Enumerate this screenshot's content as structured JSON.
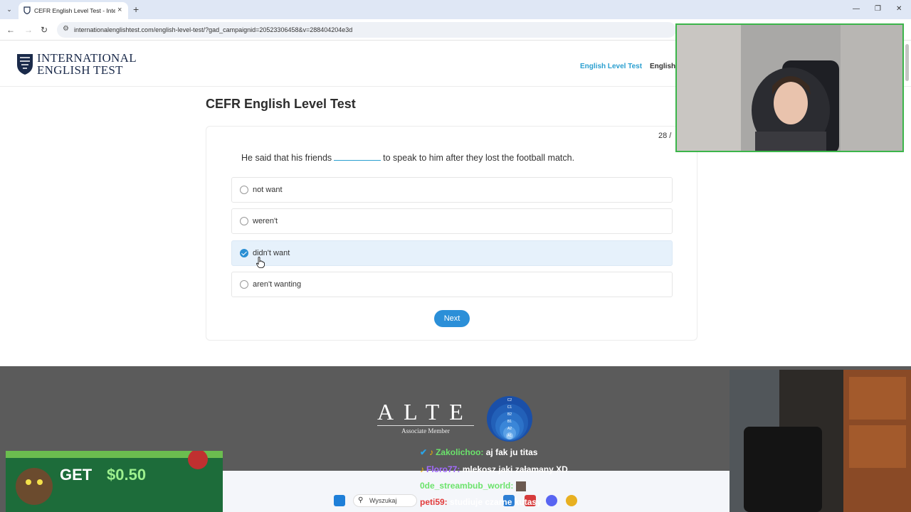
{
  "browser": {
    "tab_title": "CEFR English Level Test - Intern",
    "url": "internationalenglishtest.com/english-level-test/?gad_campaignid=20523306458&v=288404204e3d"
  },
  "site": {
    "logo_line1": "INTERNATIONAL",
    "logo_line2": "ENGLISH TEST",
    "nav_active": "English Level Test",
    "nav_second": "English"
  },
  "test": {
    "title": "CEFR English Level Test",
    "counter": "28 /",
    "question_before": "He said that his friends",
    "question_after": "to speak to him after they lost the football match.",
    "options": [
      {
        "label": "not want",
        "selected": false
      },
      {
        "label": "weren't",
        "selected": false
      },
      {
        "label": "didn't want",
        "selected": true
      },
      {
        "label": "aren't wanting",
        "selected": false
      }
    ],
    "next_label": "Next"
  },
  "footer": {
    "alte_title": "ALTE",
    "alte_subtitle": "Associate Member",
    "cefr_levels": [
      "C2",
      "C1",
      "B2",
      "B1",
      "A2",
      "A1"
    ]
  },
  "overlay": {
    "ad_get": "GET",
    "ad_amount": "$0.50",
    "chat": [
      {
        "user": "Zakolichoo:",
        "message": "aj fak ju titas",
        "user_color": "#6be36b"
      },
      {
        "user": "Floro77:",
        "message": "mlekosz jaki załamany XD",
        "user_color": "#a36bff"
      },
      {
        "user": "0de_streambub_world:",
        "message": "",
        "user_color": "#6be36b"
      },
      {
        "user": "peti59:",
        "message": "studiuje czarne kutasy",
        "user_color": "#e23b3b"
      }
    ],
    "taskbar_search": "Wyszukaj"
  }
}
